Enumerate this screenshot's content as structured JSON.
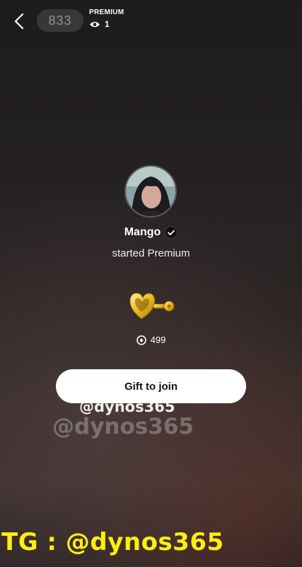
{
  "header": {
    "group_icon_text": "833",
    "label": "PREMIUM",
    "viewer_count": "1"
  },
  "profile": {
    "username": "Mango",
    "verified": true,
    "status_text": "started Premium"
  },
  "gift": {
    "icon": "golden-heart-key-icon",
    "price": "499"
  },
  "action": {
    "button_label": "Gift to join"
  },
  "watermarks": {
    "small": "@dynos365",
    "faded": "@dynos365",
    "banner": "TG : @dynos365"
  },
  "colors": {
    "banner_text": "#ffee11",
    "button_bg": "#ffffff"
  }
}
